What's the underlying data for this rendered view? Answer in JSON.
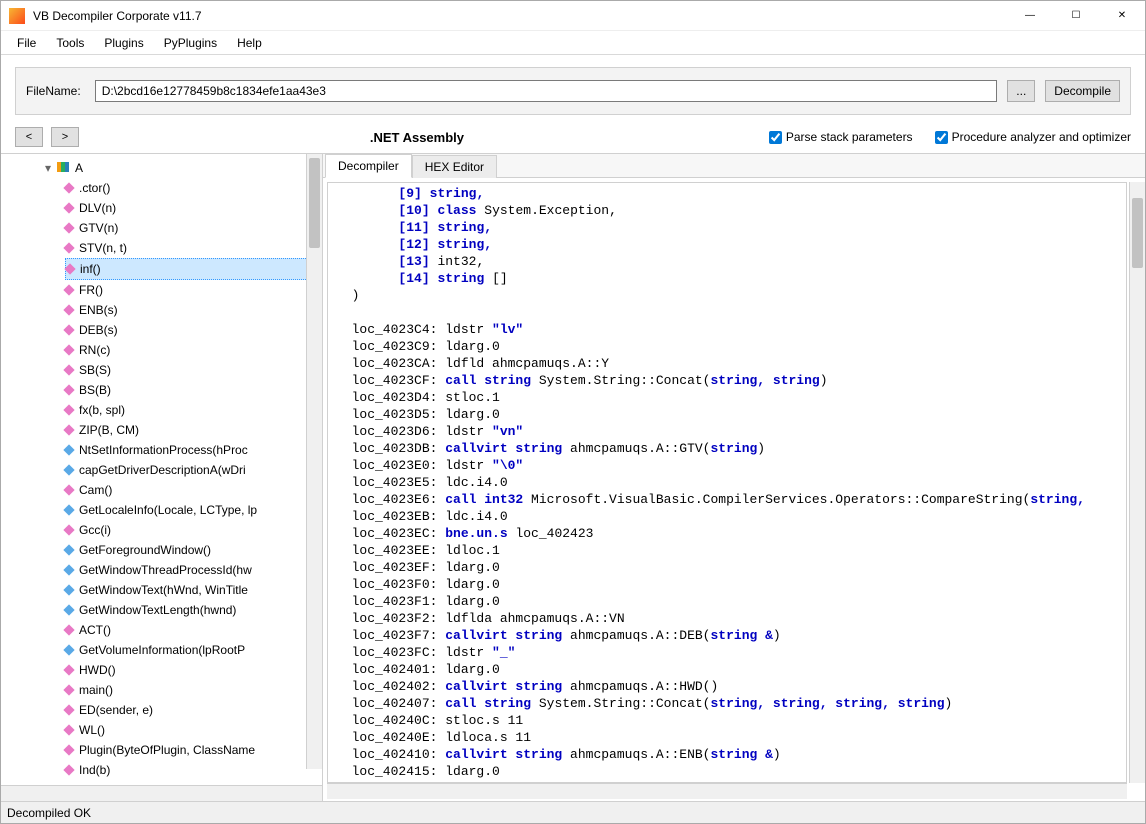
{
  "window": {
    "title": "VB Decompiler Corporate v11.7",
    "min": "—",
    "max": "☐",
    "close": "✕"
  },
  "menu": [
    "File",
    "Tools",
    "Plugins",
    "PyPlugins",
    "Help"
  ],
  "file_row": {
    "label": "FileName:",
    "path": "D:\\2bcd16e12778459b8c1834efe1aa43e3",
    "browse": "...",
    "decompile": "Decompile"
  },
  "nav": {
    "back": "<",
    "fwd": ">"
  },
  "assembly_label": ".NET Assembly",
  "checks": {
    "parse": "Parse stack parameters",
    "opt": "Procedure analyzer and optimizer"
  },
  "tree": {
    "root": "A",
    "items": [
      {
        "ico": "pink",
        "label": ".ctor()"
      },
      {
        "ico": "pink",
        "label": "DLV(n)"
      },
      {
        "ico": "pink",
        "label": "GTV(n)"
      },
      {
        "ico": "pink",
        "label": "STV(n, t)"
      },
      {
        "ico": "pink",
        "label": "inf()",
        "selected": true
      },
      {
        "ico": "pink",
        "label": "FR()"
      },
      {
        "ico": "pink",
        "label": "ENB(s)"
      },
      {
        "ico": "pink",
        "label": "DEB(s)"
      },
      {
        "ico": "pink",
        "label": "RN(c)"
      },
      {
        "ico": "pink",
        "label": "SB(S)"
      },
      {
        "ico": "pink",
        "label": "BS(B)"
      },
      {
        "ico": "pink",
        "label": "fx(b, spl)"
      },
      {
        "ico": "pink",
        "label": "ZIP(B, CM)"
      },
      {
        "ico": "blue",
        "label": "NtSetInformationProcess(hProc"
      },
      {
        "ico": "blue",
        "label": "capGetDriverDescriptionA(wDri"
      },
      {
        "ico": "pink",
        "label": "Cam()"
      },
      {
        "ico": "blue",
        "label": "GetLocaleInfo(Locale, LCType, lp"
      },
      {
        "ico": "pink",
        "label": "Gcc(i)"
      },
      {
        "ico": "blue",
        "label": "GetForegroundWindow()"
      },
      {
        "ico": "blue",
        "label": "GetWindowThreadProcessId(hw"
      },
      {
        "ico": "blue",
        "label": "GetWindowText(hWnd, WinTitle"
      },
      {
        "ico": "blue",
        "label": "GetWindowTextLength(hwnd)"
      },
      {
        "ico": "pink",
        "label": "ACT()"
      },
      {
        "ico": "blue",
        "label": "GetVolumeInformation(lpRootP"
      },
      {
        "ico": "pink",
        "label": "HWD()"
      },
      {
        "ico": "pink",
        "label": "main()"
      },
      {
        "ico": "pink",
        "label": "ED(sender, e)"
      },
      {
        "ico": "pink",
        "label": "WL()"
      },
      {
        "ico": "pink",
        "label": "Plugin(ByteOfPlugin, ClassName"
      },
      {
        "ico": "pink",
        "label": "Ind(b)"
      }
    ]
  },
  "tabs": {
    "decompiler": "Decompiler",
    "hex": "HEX Editor"
  },
  "code_raw": "        <span class='c-num'>[9]</span> <span class='c-kw'>string,</span>\n        <span class='c-num'>[10]</span> <span class='c-kw'>class</span> System.Exception,\n        <span class='c-num'>[11]</span> <span class='c-kw'>string,</span>\n        <span class='c-num'>[12]</span> <span class='c-kw'>string,</span>\n        <span class='c-num'>[13]</span> int32,\n        <span class='c-num'>[14]</span> <span class='c-kw'>string</span> []\n  )\n\n  loc_4023C4: ldstr <span class='c-str'>\"lv\"</span>\n  loc_4023C9: ldarg.0\n  loc_4023CA: ldfld ahmcpamuqs.A::Y\n  loc_4023CF: <span class='c-call'>call string</span> System.String::Concat(<span class='c-kw'>string, string</span>)\n  loc_4023D4: stloc.1\n  loc_4023D5: ldarg.0\n  loc_4023D6: ldstr <span class='c-str'>\"vn\"</span>\n  loc_4023DB: <span class='c-call'>callvirt string</span> ahmcpamuqs.A::GTV(<span class='c-kw'>string</span>)\n  loc_4023E0: ldstr <span class='c-str'>\"\\0\"</span>\n  loc_4023E5: ldc.i4.0\n  loc_4023E6: <span class='c-call'>call int32</span> Microsoft.VisualBasic.CompilerServices.Operators::CompareString(<span class='c-kw'>string,</span>\n  loc_4023EB: ldc.i4.0\n  loc_4023EC: <span class='c-call'>bne.un.s</span> loc_402423\n  loc_4023EE: ldloc.1\n  loc_4023EF: ldarg.0\n  loc_4023F0: ldarg.0\n  loc_4023F1: ldarg.0\n  loc_4023F2: ldflda ahmcpamuqs.A::VN\n  loc_4023F7: <span class='c-call'>callvirt string</span> ahmcpamuqs.A::DEB(<span class='c-kw'>string &amp;</span>)\n  loc_4023FC: ldstr <span class='c-str'>\"_\"</span>\n  loc_402401: ldarg.0\n  loc_402402: <span class='c-call'>callvirt string</span> ahmcpamuqs.A::HWD()\n  loc_402407: <span class='c-call'>call string</span> System.String::Concat(<span class='c-kw'>string, string, string, string</span>)\n  loc_40240C: stloc.s 11\n  loc_40240E: ldloca.s 11\n  loc_402410: <span class='c-call'>callvirt string</span> ahmcpamuqs.A::ENB(<span class='c-kw'>string &amp;</span>)\n  loc_402415: ldarg.0",
  "status": "Decompiled OK"
}
